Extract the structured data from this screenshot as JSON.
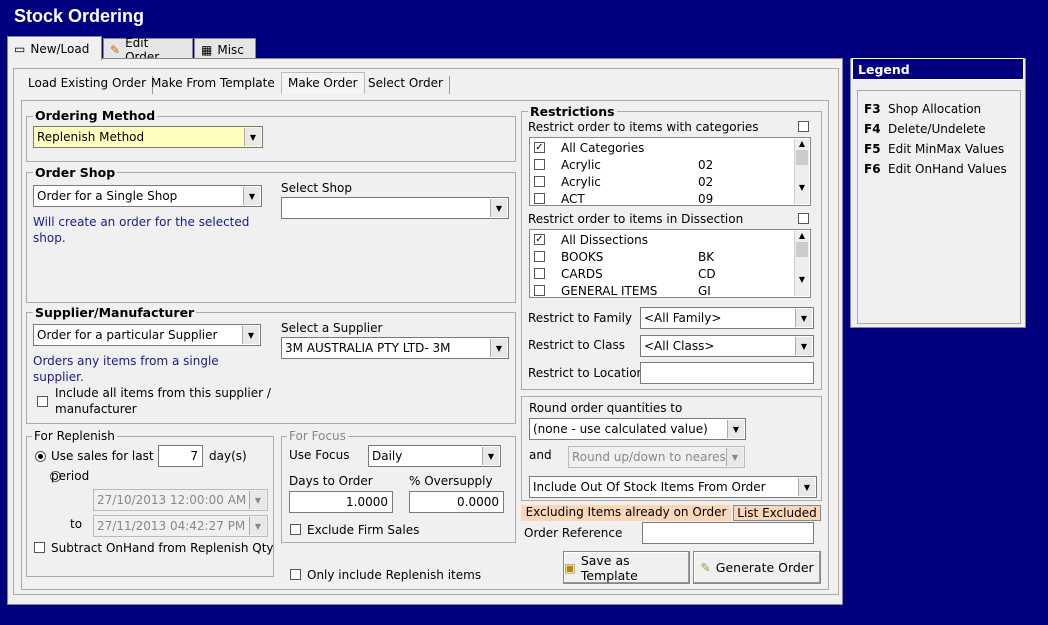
{
  "title": "Stock Ordering",
  "tabs": [
    {
      "label": "New/Load"
    },
    {
      "label": "Edit Order"
    },
    {
      "label": "Misc"
    }
  ],
  "subtabs": [
    "Load Existing Order",
    "Make From Template",
    "Make Order",
    "Select Order"
  ],
  "ordering_method": {
    "title": "Ordering Method",
    "value": "Replenish Method"
  },
  "order_shop": {
    "title": "Order Shop",
    "value": "Order for a Single Shop",
    "select_label": "Select Shop",
    "select_value": "",
    "note": "Will create an order for the selected shop."
  },
  "supplier": {
    "title": "Supplier/Manufacturer",
    "value": "Order for a particular Supplier",
    "select_label": "Select a Supplier",
    "select_value": "3M AUSTRALIA PTY LTD- 3M",
    "note": "Orders any items from a single supplier.",
    "include_all": "Include all items from this supplier / manufacturer"
  },
  "replenish": {
    "title": "For Replenish",
    "use_sales": "Use sales for last",
    "days": "7",
    "days_unit": "day(s)",
    "period": "period",
    "from": "27/10/2013 12:00:00 AM",
    "to_label": "to",
    "to": "27/11/2013 04:42:27 PM",
    "subtract": "Subtract OnHand from Replenish Qty"
  },
  "focus": {
    "title": "For Focus",
    "use_focus": "Use Focus",
    "focus_value": "Daily",
    "days_label": "Days to Order",
    "days_value": "1.0000",
    "oversupply_label": "% Oversupply",
    "oversupply_value": "0.0000",
    "exclude_firm": "Exclude Firm Sales",
    "only_replenish": "Only include Replenish items"
  },
  "restrictions": {
    "title": "Restrictions",
    "cat_label": "Restrict order to items with categories",
    "categories": [
      {
        "name": "All Categories",
        "code": "",
        "checked": true
      },
      {
        "name": "Acrylic",
        "code": "02",
        "checked": false
      },
      {
        "name": "Acrylic",
        "code": "02",
        "checked": false
      },
      {
        "name": "ACT",
        "code": "09",
        "checked": false
      }
    ],
    "dis_label": "Restrict order to items in Dissection",
    "dissections": [
      {
        "name": "All Dissections",
        "code": "",
        "checked": true
      },
      {
        "name": "BOOKS",
        "code": "BK",
        "checked": false
      },
      {
        "name": "CARDS",
        "code": "CD",
        "checked": false
      },
      {
        "name": "GENERAL ITEMS",
        "code": "GI",
        "checked": false
      }
    ],
    "family_label": "Restrict to Family",
    "family_value": "<All Family>",
    "class_label": "Restrict to Class",
    "class_value": "<All Class>",
    "location_label": "Restrict to Location",
    "location_value": ""
  },
  "rounding": {
    "label": "Round order quantities to",
    "value": "(none - use calculated value)",
    "and": "and",
    "and_value": "Round up/down to nearest",
    "stock": "Include Out Of Stock Items From Order"
  },
  "excluding": {
    "text": "Excluding Items already on Order",
    "link": "List Excluded"
  },
  "order_ref": {
    "label": "Order Reference",
    "value": ""
  },
  "buttons": {
    "template": "Save as Template",
    "generate": "Generate Order"
  },
  "legend": {
    "title": "Legend",
    "items": [
      {
        "key": "F3",
        "label": "Shop Allocation"
      },
      {
        "key": "F4",
        "label": "Delete/Undelete"
      },
      {
        "key": "F5",
        "label": "Edit MinMax Values"
      },
      {
        "key": "F6",
        "label": "Edit OnHand Values"
      }
    ]
  }
}
